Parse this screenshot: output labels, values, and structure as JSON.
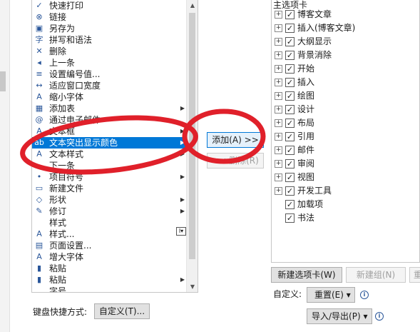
{
  "commands": [
    {
      "label": "快速打印",
      "icon": "quick-print-icon",
      "arrow": false,
      "selected": false
    },
    {
      "label": "链接",
      "icon": "link-icon",
      "arrow": false,
      "selected": false
    },
    {
      "label": "另存为",
      "icon": "save-as-icon",
      "arrow": false,
      "selected": false
    },
    {
      "label": "拼写和语法",
      "icon": "spelling-icon",
      "arrow": false,
      "selected": false
    },
    {
      "label": "删除",
      "icon": "delete-icon",
      "arrow": false,
      "selected": false
    },
    {
      "label": "上一条",
      "icon": "previous-icon",
      "arrow": false,
      "selected": false
    },
    {
      "label": "设置编号值...",
      "icon": "numbering-icon",
      "arrow": false,
      "selected": false
    },
    {
      "label": "适应窗口宽度",
      "icon": "fit-width-icon",
      "arrow": false,
      "selected": false
    },
    {
      "label": "缩小字体",
      "icon": "shrink-font-icon",
      "arrow": false,
      "selected": false
    },
    {
      "label": "添加表",
      "icon": "table-icon",
      "arrow": true,
      "selected": false
    },
    {
      "label": "通过电子邮件",
      "icon": "email-icon",
      "arrow": false,
      "selected": false
    },
    {
      "label": "文本框",
      "icon": "textbox-icon",
      "arrow": true,
      "selected": false
    },
    {
      "label": "文本突出显示颜色",
      "icon": "highlight-icon",
      "arrow": true,
      "selected": true
    },
    {
      "label": "文本样式",
      "icon": "text-style-icon",
      "arrow": true,
      "selected": false
    },
    {
      "label": "下一条",
      "icon": "next-icon",
      "arrow": false,
      "selected": false
    },
    {
      "label": "项目符号",
      "icon": "bullets-icon",
      "arrow": true,
      "selected": false
    },
    {
      "label": "新建文件",
      "icon": "new-file-icon",
      "arrow": false,
      "selected": false
    },
    {
      "label": "形状",
      "icon": "shapes-icon",
      "arrow": true,
      "selected": false
    },
    {
      "label": "修订",
      "icon": "track-changes-icon",
      "arrow": true,
      "selected": false
    },
    {
      "label": "样式",
      "icon": "",
      "arrow": false,
      "selected": false
    },
    {
      "label": "样式...",
      "icon": "styles-icon",
      "arrow": false,
      "selected": false
    },
    {
      "label": "页面设置...",
      "icon": "page-setup-icon",
      "arrow": false,
      "selected": false
    },
    {
      "label": "增大字体",
      "icon": "grow-font-icon",
      "arrow": false,
      "selected": false
    },
    {
      "label": "粘贴",
      "icon": "paste-icon",
      "arrow": false,
      "selected": false
    },
    {
      "label": "粘贴",
      "icon": "paste-icon",
      "arrow": true,
      "selected": false
    },
    {
      "label": "字号",
      "icon": "",
      "arrow": false,
      "selected": false
    }
  ],
  "buttons": {
    "add": "添加(A) >>",
    "remove": "<< 删除(R)",
    "new_tab": "新建选项卡(W)",
    "new_group": "新建组(N)",
    "rename": "重",
    "reset": "重置(E) ▾",
    "import_export": "导入/导出(P) ▾",
    "customize": "自定义(T)..."
  },
  "tree": {
    "header": "主选项卡",
    "items": [
      {
        "label": "博客文章",
        "expand": "+",
        "checked": true
      },
      {
        "label": "插入(博客文章)",
        "expand": "+",
        "checked": true
      },
      {
        "label": "大纲显示",
        "expand": "+",
        "checked": true
      },
      {
        "label": "背景消除",
        "expand": "+",
        "checked": true
      },
      {
        "label": "开始",
        "expand": "+",
        "checked": true
      },
      {
        "label": "插入",
        "expand": "+",
        "checked": true
      },
      {
        "label": "绘图",
        "expand": "+",
        "checked": true
      },
      {
        "label": "设计",
        "expand": "+",
        "checked": true
      },
      {
        "label": "布局",
        "expand": "+",
        "checked": true
      },
      {
        "label": "引用",
        "expand": "+",
        "checked": true
      },
      {
        "label": "邮件",
        "expand": "+",
        "checked": true
      },
      {
        "label": "审阅",
        "expand": "+",
        "checked": true
      },
      {
        "label": "视图",
        "expand": "+",
        "checked": true
      },
      {
        "label": "开发工具",
        "expand": "+",
        "checked": true
      },
      {
        "label": "加载项",
        "expand": "",
        "checked": true
      },
      {
        "label": "书法",
        "expand": "",
        "checked": true
      }
    ]
  },
  "labels": {
    "customizations": "自定义:",
    "keyboard_shortcuts": "键盘快捷方式:"
  },
  "colors": {
    "selection": "#0078d7",
    "annotation": "#e0202a"
  }
}
